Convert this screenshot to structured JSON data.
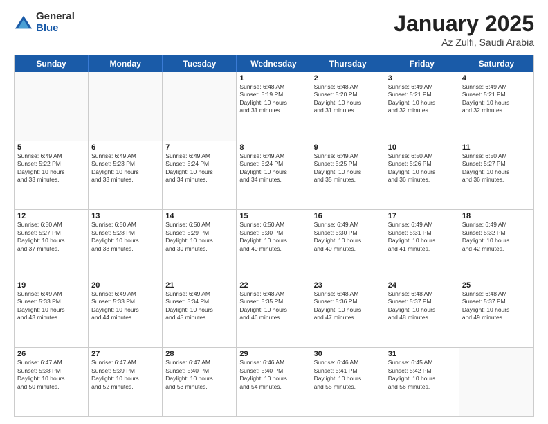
{
  "logo": {
    "general": "General",
    "blue": "Blue"
  },
  "header": {
    "month": "January 2025",
    "location": "Az Zulfi, Saudi Arabia"
  },
  "dayHeaders": [
    "Sunday",
    "Monday",
    "Tuesday",
    "Wednesday",
    "Thursday",
    "Friday",
    "Saturday"
  ],
  "weeks": [
    [
      {
        "day": "",
        "info": ""
      },
      {
        "day": "",
        "info": ""
      },
      {
        "day": "",
        "info": ""
      },
      {
        "day": "1",
        "info": "Sunrise: 6:48 AM\nSunset: 5:19 PM\nDaylight: 10 hours\nand 31 minutes."
      },
      {
        "day": "2",
        "info": "Sunrise: 6:48 AM\nSunset: 5:20 PM\nDaylight: 10 hours\nand 31 minutes."
      },
      {
        "day": "3",
        "info": "Sunrise: 6:49 AM\nSunset: 5:21 PM\nDaylight: 10 hours\nand 32 minutes."
      },
      {
        "day": "4",
        "info": "Sunrise: 6:49 AM\nSunset: 5:21 PM\nDaylight: 10 hours\nand 32 minutes."
      }
    ],
    [
      {
        "day": "5",
        "info": "Sunrise: 6:49 AM\nSunset: 5:22 PM\nDaylight: 10 hours\nand 33 minutes."
      },
      {
        "day": "6",
        "info": "Sunrise: 6:49 AM\nSunset: 5:23 PM\nDaylight: 10 hours\nand 33 minutes."
      },
      {
        "day": "7",
        "info": "Sunrise: 6:49 AM\nSunset: 5:24 PM\nDaylight: 10 hours\nand 34 minutes."
      },
      {
        "day": "8",
        "info": "Sunrise: 6:49 AM\nSunset: 5:24 PM\nDaylight: 10 hours\nand 34 minutes."
      },
      {
        "day": "9",
        "info": "Sunrise: 6:49 AM\nSunset: 5:25 PM\nDaylight: 10 hours\nand 35 minutes."
      },
      {
        "day": "10",
        "info": "Sunrise: 6:50 AM\nSunset: 5:26 PM\nDaylight: 10 hours\nand 36 minutes."
      },
      {
        "day": "11",
        "info": "Sunrise: 6:50 AM\nSunset: 5:27 PM\nDaylight: 10 hours\nand 36 minutes."
      }
    ],
    [
      {
        "day": "12",
        "info": "Sunrise: 6:50 AM\nSunset: 5:27 PM\nDaylight: 10 hours\nand 37 minutes."
      },
      {
        "day": "13",
        "info": "Sunrise: 6:50 AM\nSunset: 5:28 PM\nDaylight: 10 hours\nand 38 minutes."
      },
      {
        "day": "14",
        "info": "Sunrise: 6:50 AM\nSunset: 5:29 PM\nDaylight: 10 hours\nand 39 minutes."
      },
      {
        "day": "15",
        "info": "Sunrise: 6:50 AM\nSunset: 5:30 PM\nDaylight: 10 hours\nand 40 minutes."
      },
      {
        "day": "16",
        "info": "Sunrise: 6:49 AM\nSunset: 5:30 PM\nDaylight: 10 hours\nand 40 minutes."
      },
      {
        "day": "17",
        "info": "Sunrise: 6:49 AM\nSunset: 5:31 PM\nDaylight: 10 hours\nand 41 minutes."
      },
      {
        "day": "18",
        "info": "Sunrise: 6:49 AM\nSunset: 5:32 PM\nDaylight: 10 hours\nand 42 minutes."
      }
    ],
    [
      {
        "day": "19",
        "info": "Sunrise: 6:49 AM\nSunset: 5:33 PM\nDaylight: 10 hours\nand 43 minutes."
      },
      {
        "day": "20",
        "info": "Sunrise: 6:49 AM\nSunset: 5:33 PM\nDaylight: 10 hours\nand 44 minutes."
      },
      {
        "day": "21",
        "info": "Sunrise: 6:49 AM\nSunset: 5:34 PM\nDaylight: 10 hours\nand 45 minutes."
      },
      {
        "day": "22",
        "info": "Sunrise: 6:48 AM\nSunset: 5:35 PM\nDaylight: 10 hours\nand 46 minutes."
      },
      {
        "day": "23",
        "info": "Sunrise: 6:48 AM\nSunset: 5:36 PM\nDaylight: 10 hours\nand 47 minutes."
      },
      {
        "day": "24",
        "info": "Sunrise: 6:48 AM\nSunset: 5:37 PM\nDaylight: 10 hours\nand 48 minutes."
      },
      {
        "day": "25",
        "info": "Sunrise: 6:48 AM\nSunset: 5:37 PM\nDaylight: 10 hours\nand 49 minutes."
      }
    ],
    [
      {
        "day": "26",
        "info": "Sunrise: 6:47 AM\nSunset: 5:38 PM\nDaylight: 10 hours\nand 50 minutes."
      },
      {
        "day": "27",
        "info": "Sunrise: 6:47 AM\nSunset: 5:39 PM\nDaylight: 10 hours\nand 52 minutes."
      },
      {
        "day": "28",
        "info": "Sunrise: 6:47 AM\nSunset: 5:40 PM\nDaylight: 10 hours\nand 53 minutes."
      },
      {
        "day": "29",
        "info": "Sunrise: 6:46 AM\nSunset: 5:40 PM\nDaylight: 10 hours\nand 54 minutes."
      },
      {
        "day": "30",
        "info": "Sunrise: 6:46 AM\nSunset: 5:41 PM\nDaylight: 10 hours\nand 55 minutes."
      },
      {
        "day": "31",
        "info": "Sunrise: 6:45 AM\nSunset: 5:42 PM\nDaylight: 10 hours\nand 56 minutes."
      },
      {
        "day": "",
        "info": ""
      }
    ]
  ]
}
